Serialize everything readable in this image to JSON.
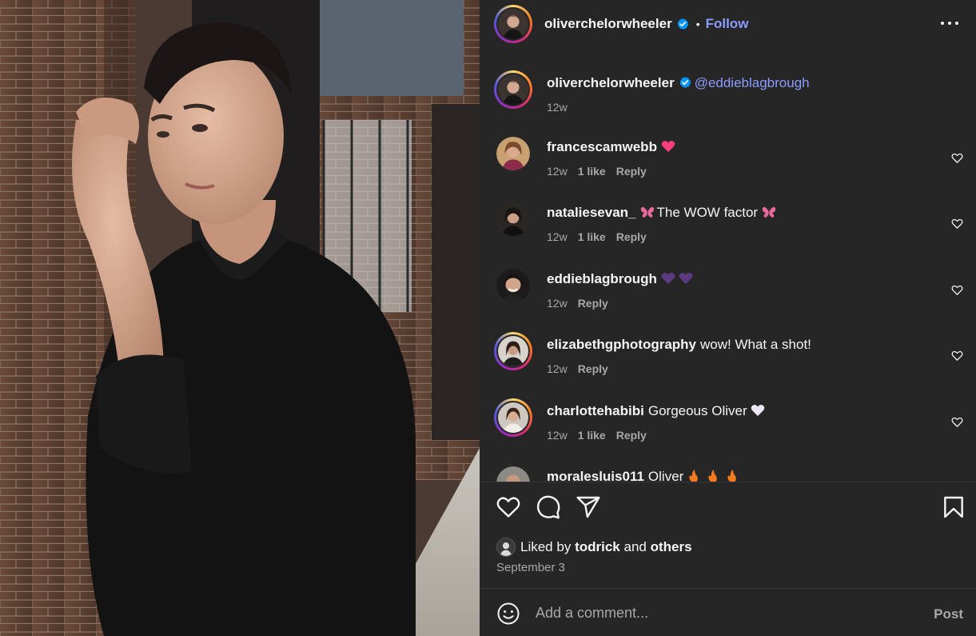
{
  "post": {
    "author": "oliverchelorwheeler",
    "header_author": "oliverchelorwheeler",
    "follow_label": "Follow",
    "dot": "•",
    "caption_mention": "@eddieblagbrough",
    "caption_time": "12w"
  },
  "comments": [
    {
      "user": "francescamwebb",
      "text": "",
      "emoji": "pink-heart",
      "time": "12w",
      "likes": "1 like",
      "reply": "Reply"
    },
    {
      "user": "nataliesevan_",
      "text": "The WOW factor",
      "emoji": "butterfly",
      "time": "12w",
      "likes": "1 like",
      "reply": "Reply"
    },
    {
      "user": "eddieblagbrough",
      "text": "",
      "emoji": "purple-hearts",
      "time": "12w",
      "likes": "",
      "reply": "Reply"
    },
    {
      "user": "elizabethgphotography",
      "text": "wow! What a shot!",
      "emoji": "",
      "time": "12w",
      "likes": "",
      "reply": "Reply"
    },
    {
      "user": "charlottehabibi",
      "text": "Gorgeous Oliver",
      "emoji": "white-heart",
      "time": "12w",
      "likes": "1 like",
      "reply": "Reply"
    },
    {
      "user": "moralesluis011",
      "text": "Oliver",
      "emoji": "fire",
      "time": "",
      "likes": "",
      "reply": ""
    }
  ],
  "likes": {
    "prefix": "Liked by",
    "user": "todrick",
    "conj": "and",
    "others": "others"
  },
  "date": "September 3",
  "composer": {
    "placeholder": "Add a comment...",
    "post_label": "Post"
  },
  "colors": {
    "panel_bg": "#262626",
    "link": "#8c9bff",
    "muted": "#a8a8a8",
    "verified": "#0095f6"
  }
}
